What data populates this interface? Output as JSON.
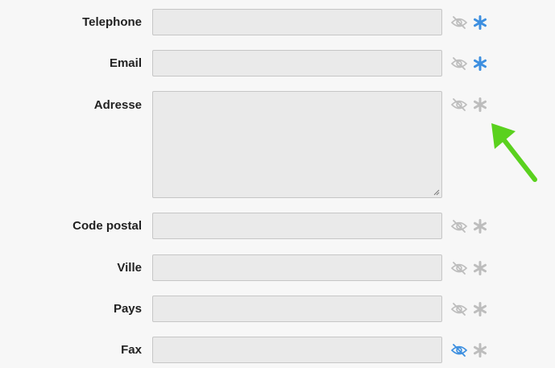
{
  "colors": {
    "active": "#3d8fe0",
    "inactive": "#bdbdbd",
    "arrow": "#5ad11e"
  },
  "fields": [
    {
      "key": "telephone",
      "label": "Telephone",
      "value": "",
      "multiline": false,
      "visible_icon": "eye-slash-icon",
      "visible_active": false,
      "required_icon": "asterisk-icon",
      "required_active": true
    },
    {
      "key": "email",
      "label": "Email",
      "value": "",
      "multiline": false,
      "visible_icon": "eye-slash-icon",
      "visible_active": false,
      "required_icon": "asterisk-icon",
      "required_active": true
    },
    {
      "key": "adresse",
      "label": "Adresse",
      "value": "",
      "multiline": true,
      "visible_icon": "eye-slash-icon",
      "visible_active": false,
      "required_icon": "asterisk-icon",
      "required_active": false
    },
    {
      "key": "code_postal",
      "label": "Code postal",
      "value": "",
      "multiline": false,
      "visible_icon": "eye-slash-icon",
      "visible_active": false,
      "required_icon": "asterisk-icon",
      "required_active": false
    },
    {
      "key": "ville",
      "label": "Ville",
      "value": "",
      "multiline": false,
      "visible_icon": "eye-slash-icon",
      "visible_active": false,
      "required_icon": "asterisk-icon",
      "required_active": false
    },
    {
      "key": "pays",
      "label": "Pays",
      "value": "",
      "multiline": false,
      "visible_icon": "eye-slash-icon",
      "visible_active": false,
      "required_icon": "asterisk-icon",
      "required_active": false
    },
    {
      "key": "fax",
      "label": "Fax",
      "value": "",
      "multiline": false,
      "visible_icon": "eye-slash-icon",
      "visible_active": true,
      "required_icon": "asterisk-icon",
      "required_active": false
    }
  ],
  "annotation": {
    "icon": "arrow-pointer-icon"
  }
}
